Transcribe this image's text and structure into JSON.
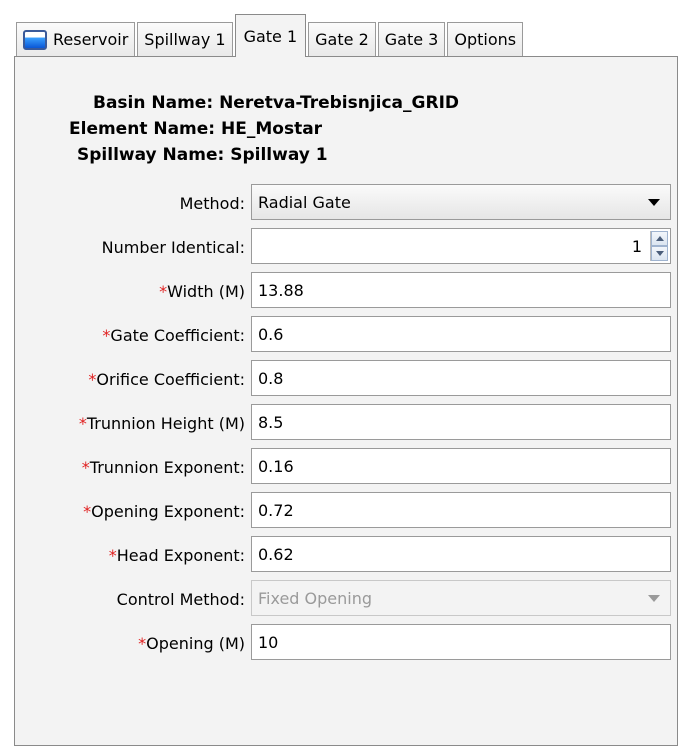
{
  "tabs": [
    {
      "label": "Reservoir",
      "icon": "reservoir-icon"
    },
    {
      "label": "Spillway 1"
    },
    {
      "label": "Gate 1",
      "active": true
    },
    {
      "label": "Gate 2"
    },
    {
      "label": "Gate 3"
    },
    {
      "label": "Options"
    }
  ],
  "header": {
    "basin_label": "Basin Name:",
    "basin_value": "Neretva-Trebisnjica_GRID",
    "element_label": "Element Name:",
    "element_value": "HE_Mostar",
    "spillway_label": "Spillway Name:",
    "spillway_value": "Spillway 1"
  },
  "form": {
    "method": {
      "label": "Method:",
      "value": "Radial Gate"
    },
    "number_identical": {
      "label": "Number Identical:",
      "value": "1"
    },
    "width": {
      "star": "*",
      "label": "Width (M)",
      "value": "13.88"
    },
    "gate_coefficient": {
      "star": "*",
      "label": "Gate Coefficient:",
      "value": "0.6"
    },
    "orifice_coefficient": {
      "star": "*",
      "label": "Orifice Coefficient:",
      "value": "0.8"
    },
    "trunnion_height": {
      "star": "*",
      "label": "Trunnion Height (M)",
      "value": "8.5"
    },
    "trunnion_exponent": {
      "star": "*",
      "label": "Trunnion Exponent:",
      "value": "0.16"
    },
    "opening_exponent": {
      "star": "*",
      "label": "Opening Exponent:",
      "value": "0.72"
    },
    "head_exponent": {
      "star": "*",
      "label": "Head Exponent:",
      "value": "0.62"
    },
    "control_method": {
      "label": "Control Method:",
      "value": "Fixed Opening"
    },
    "opening": {
      "star": "*",
      "label": "Opening (M)",
      "value": "10"
    }
  },
  "colors": {
    "required_star": "#e02020",
    "panel_bg": "#f3f3f3"
  }
}
